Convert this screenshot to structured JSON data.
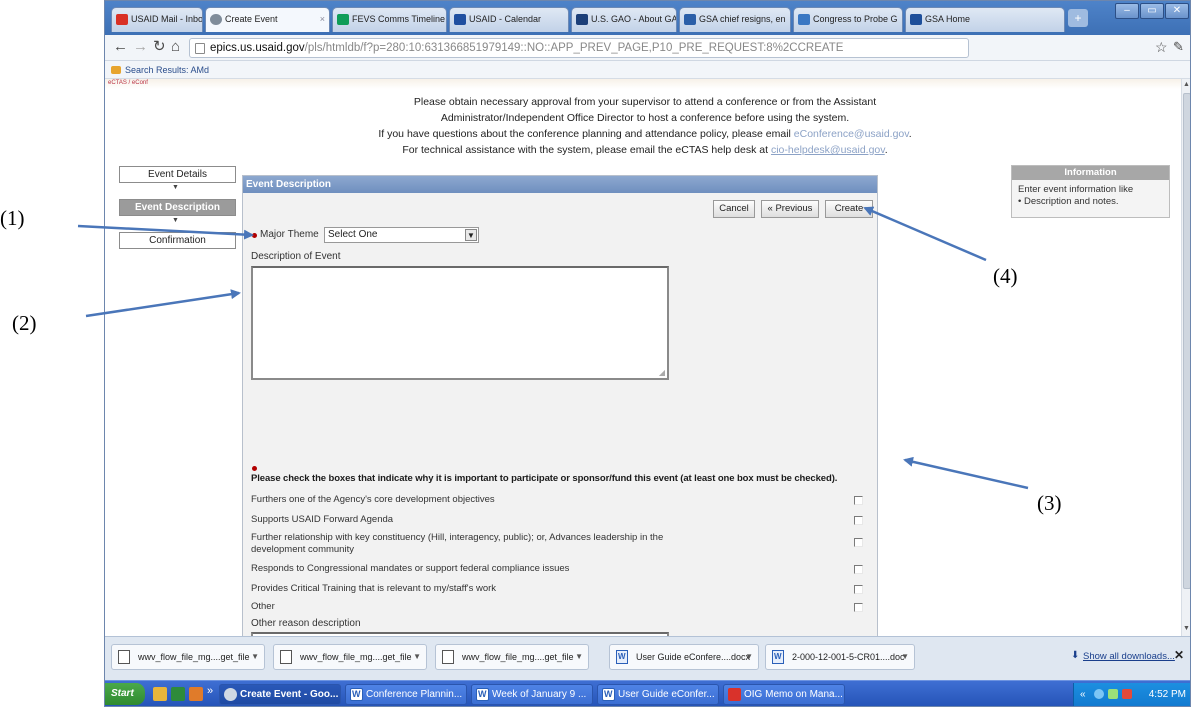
{
  "browser": {
    "tabs": [
      {
        "label": "USAID Mail - Inbox (2 ×",
        "icon_color": "#d93025"
      },
      {
        "label": "Create Event",
        "icon_color": "#7f8c9a"
      },
      {
        "label": "FEVS Comms Timeline",
        "icon_color": "#0f9d58"
      },
      {
        "label": "USAID - Calendar",
        "icon_color": "#1f4fa0"
      },
      {
        "label": "U.S. GAO - About GA",
        "icon_color": "#1c3f79"
      },
      {
        "label": "GSA chief resigns, en",
        "icon_color": "#2b5fa8"
      },
      {
        "label": "Congress to Probe G",
        "icon_color": "#3b78c3"
      },
      {
        "label": "GSA Home",
        "icon_color": "#1e4f9a"
      }
    ],
    "new_tab_glyph": "+",
    "url_host": "epics.us.usaid.gov",
    "url_path": "/pls/htmldb/f?p=280:10:631366851979149::NO::APP_PREV_PAGE,P10_PRE_REQUEST:8%2CCREATE",
    "bookmark": "Search Results: AMd",
    "top_fragment": "eCTAS / eConf"
  },
  "notice": {
    "line1": "Please obtain necessary approval from your supervisor to attend a conference or from the Assistant",
    "line2": "Administrator/Independent Office Director to host a conference before using the system.",
    "line3_prefix": "If you have questions about the conference planning and attendance policy, please email ",
    "line3_email": "eConference@usaid.gov",
    "line3_suffix": ".",
    "line4_prefix": "For technical assistance with the system, please email the eCTAS help desk at ",
    "line4_email": "cio-helpdesk@usaid.gov",
    "line4_suffix": "."
  },
  "wizard": {
    "steps": [
      "Event Details",
      "Event Description",
      "Confirmation"
    ],
    "active": 1,
    "arrow_glyph": "▼"
  },
  "form": {
    "panel_title": "Event Description",
    "buttons": {
      "cancel": "Cancel",
      "previous": "« Previous",
      "create": "Create"
    },
    "major_theme_label": "Major Theme",
    "major_theme_value": "Select One",
    "description_label": "Description of Event",
    "description_value": "",
    "checkbox_instruction": "Please check the boxes that indicate why it is important to participate or sponsor/fund this event (at least one box must be checked).",
    "reasons": [
      {
        "text": "Furthers one of the Agency's core development objectives",
        "checked": false
      },
      {
        "text": "Supports USAID Forward Agenda",
        "checked": false
      },
      {
        "text": "Further relationship with key constituency (Hill, interagency, public); or, Advances leadership in the development community",
        "checked": false
      },
      {
        "text": "Responds to Congressional mandates or support federal compliance issues",
        "checked": false
      },
      {
        "text": "Provides Critical Training that is relevant to my/staff's work",
        "checked": false
      },
      {
        "text": "Other",
        "checked": false
      }
    ],
    "other_reason_label": "Other reason description",
    "other_reason_value": ""
  },
  "info": {
    "title": "Information",
    "line1": "Enter event information like",
    "bullet": "Description and notes."
  },
  "downloads": {
    "items": [
      {
        "name": "wwv_flow_file_mg....get_file",
        "kind": "file"
      },
      {
        "name": "wwv_flow_file_mg....get_file",
        "kind": "file"
      },
      {
        "name": "wwv_flow_file_mg....get_file",
        "kind": "file"
      },
      {
        "name": "User Guide eConfere....docx",
        "kind": "word"
      },
      {
        "name": "2-000-12-001-5-CR01....doc",
        "kind": "word"
      }
    ],
    "show_all": "Show all downloads...",
    "close_glyph": "✕"
  },
  "taskbar": {
    "start": "Start",
    "quicklaunch_more": "»",
    "items": [
      {
        "label": "Create Event - Goo...",
        "active": true
      },
      {
        "label": "Conference Plannin...",
        "active": false
      },
      {
        "label": "Week of January 9 ...",
        "active": false
      },
      {
        "label": "User Guide eConfer...",
        "active": false
      },
      {
        "label": "OIG Memo on Mana...",
        "active": false
      }
    ],
    "tray_glyph": "«",
    "clock": "4:52 PM"
  },
  "annotations": {
    "a1": "(1)",
    "a2": "(2)",
    "a3": "(3)",
    "a4": "(4)"
  },
  "colors": {
    "arrow": "#4a76b9",
    "required": "#b20000",
    "panel_header": "#7b98c5",
    "accent_link": "#8ca2c6"
  }
}
